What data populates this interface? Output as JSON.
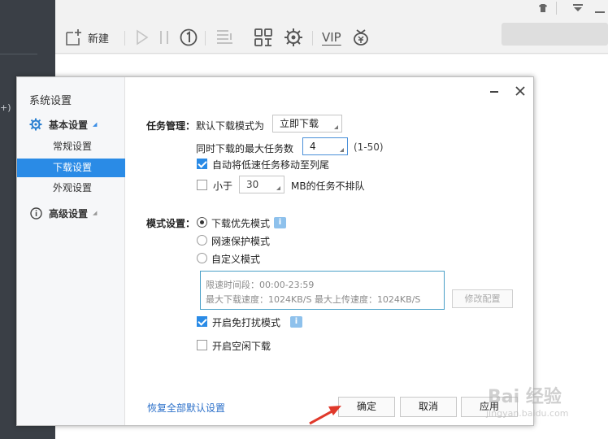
{
  "app": {
    "left_peek_text": "+)",
    "toolbar": {
      "new_label": "新建",
      "vip_label": "VIP"
    }
  },
  "dialog": {
    "title": "系统设置",
    "nav": {
      "basic_group": "基本设置",
      "items": [
        "常规设置",
        "下载设置",
        "外观设置"
      ],
      "advanced_group": "高级设置"
    },
    "task": {
      "section_label": "任务管理：",
      "default_mode_label": "默认下载模式为",
      "default_mode_value": "立即下载",
      "max_tasks_label": "同时下载的最大任务数",
      "max_tasks_value": "4",
      "max_tasks_range": "(1-50)",
      "auto_move_label": "自动将低速任务移动至列尾",
      "auto_move_checked": true,
      "less_than_label": "小于",
      "less_than_value": "30",
      "no_queue_label": "MB的任务不排队",
      "less_than_checked": false
    },
    "mode": {
      "section_label": "模式设置：",
      "options": [
        "下载优先模式",
        "网速保护模式",
        "自定义模式"
      ],
      "selected_index": 0,
      "limit_time": "限速时间段：00:00-23:59",
      "limit_speed": "最大下载速度：1024KB/S  最大上传速度：1024KB/S",
      "modify_button": "修改配置",
      "no_disturb_label": "开启免打扰模式",
      "no_disturb_checked": true,
      "idle_label": "开启空闲下载",
      "idle_checked": false
    },
    "footer": {
      "restore_link": "恢复全部默认设置",
      "ok": "确定",
      "cancel": "取消",
      "apply": "应用"
    }
  },
  "watermark": {
    "text": "Bai 经验",
    "sub": "jingyan.baidu.com"
  },
  "colors": {
    "accent": "#2a8be6",
    "link": "#2a6fc9",
    "arrow": "#e0392b"
  }
}
